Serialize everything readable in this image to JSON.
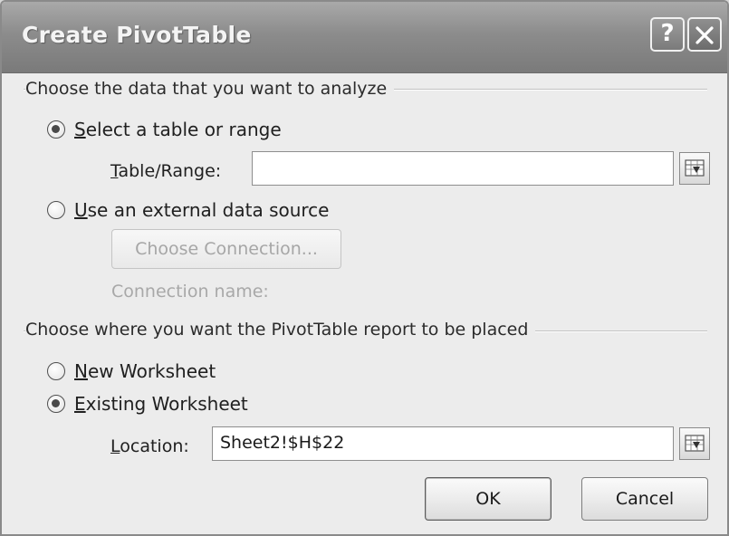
{
  "window": {
    "title": "Create PivotTable",
    "help_button": "?"
  },
  "data_source": {
    "group_label": "Choose the data that you want to analyze",
    "select_table_option": {
      "access_key": "S",
      "label_rest": "elect a table or range",
      "selected": true
    },
    "table_range": {
      "access_key": "T",
      "label_rest": "able/Range:",
      "value": ""
    },
    "external_source_option": {
      "access_key": "U",
      "label_rest": "se an external data source",
      "selected": false
    },
    "choose_connection_button": "Choose Connection...",
    "connection_name_label": "Connection name:"
  },
  "placement": {
    "group_label": "Choose where you want the PivotTable report to be placed",
    "new_worksheet_option": {
      "access_key": "N",
      "label_rest": "ew Worksheet",
      "selected": false
    },
    "existing_worksheet_option": {
      "access_key": "E",
      "label_rest": "xisting Worksheet",
      "selected": true
    },
    "location": {
      "access_key": "L",
      "label_rest": "ocation:",
      "value": "Sheet2!$H$22"
    }
  },
  "buttons": {
    "ok": "OK",
    "cancel": "Cancel"
  },
  "icons": {
    "help": "question-mark-icon",
    "close": "close-icon",
    "range_picker": "range-collapse-icon"
  }
}
